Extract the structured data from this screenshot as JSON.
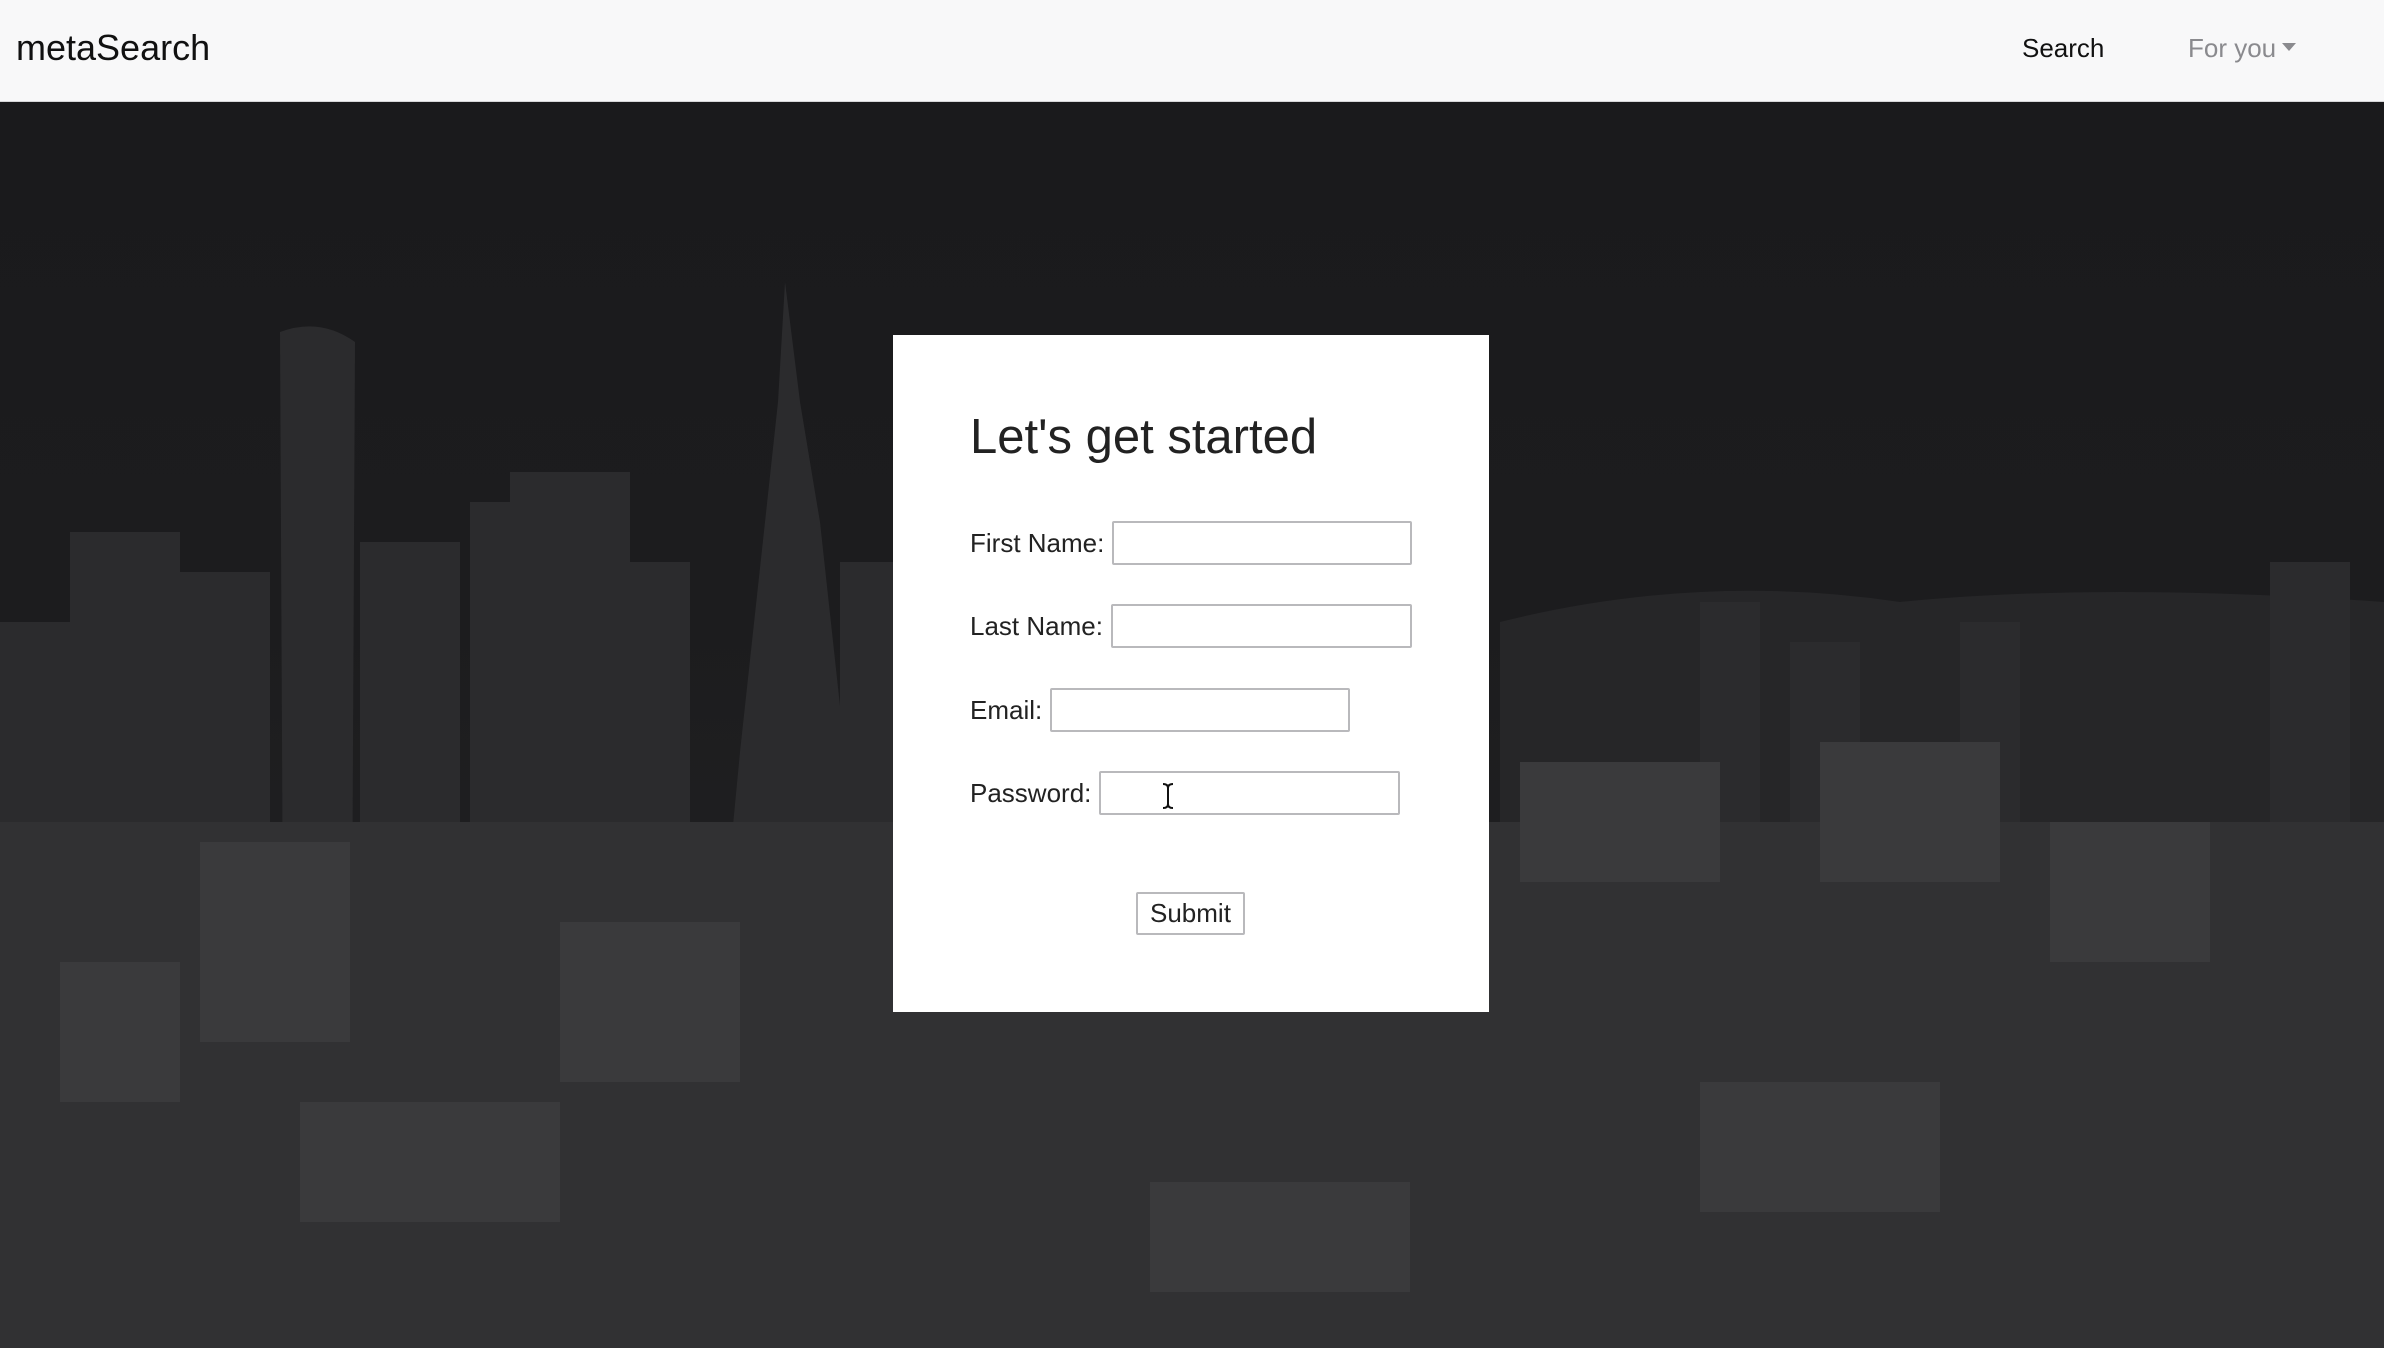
{
  "navbar": {
    "brand": "metaSearch",
    "links": [
      {
        "label": "Search"
      },
      {
        "label": "For you"
      }
    ]
  },
  "form": {
    "title": "Let's get started",
    "fields": [
      {
        "label": "First Name:",
        "value": "",
        "placeholder": ""
      },
      {
        "label": "Last Name:",
        "value": "",
        "placeholder": ""
      },
      {
        "label": "Email:",
        "value": "",
        "placeholder": ""
      },
      {
        "label": "Password:",
        "value": "",
        "placeholder": ""
      }
    ],
    "submit_label": "Submit"
  },
  "icons": {
    "dropdown": "caret-down-icon",
    "cursor": "text-cursor-icon"
  },
  "colors": {
    "navbar_bg": "#f8f8f9",
    "overlay_bg": "#1e1e20",
    "card_bg": "#ffffff",
    "muted_link": "#8a8a8e"
  }
}
